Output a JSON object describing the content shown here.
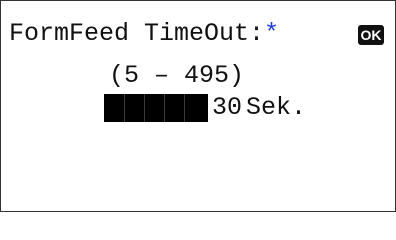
{
  "setting": {
    "label": "FormFeed TimeOut:",
    "required_mark": "*",
    "confirm_key": "OK"
  },
  "range_text": "(5 – 495)",
  "value_field": {
    "value": "30",
    "unit": "Sek."
  },
  "colors": {
    "required_mark": "#1f3fd0",
    "field_background": "#000000"
  }
}
